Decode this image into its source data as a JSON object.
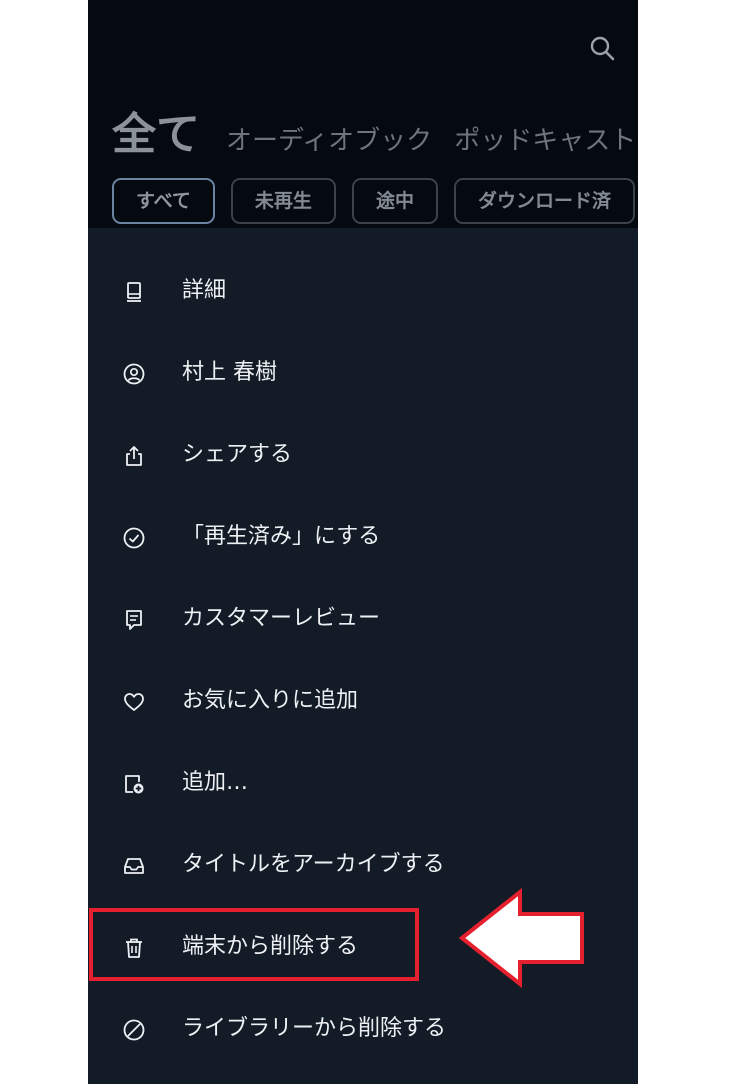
{
  "header": {
    "search_icon": "search-icon",
    "tabs": [
      {
        "label": "全て",
        "active": true
      },
      {
        "label": "オーディオブック",
        "active": false
      },
      {
        "label": "ポッドキャスト",
        "active": false
      }
    ],
    "filters": [
      {
        "label": "すべて",
        "selected": true
      },
      {
        "label": "未再生",
        "selected": false
      },
      {
        "label": "途中",
        "selected": false
      },
      {
        "label": "ダウンロード済",
        "selected": false
      }
    ]
  },
  "menu": {
    "items": [
      {
        "label": "詳細",
        "icon": "book-icon"
      },
      {
        "label": "村上 春樹",
        "icon": "person-icon"
      },
      {
        "label": "シェアする",
        "icon": "share-icon"
      },
      {
        "label": "「再生済み」にする",
        "icon": "check-circle-icon"
      },
      {
        "label": "カスタマーレビュー",
        "icon": "review-icon"
      },
      {
        "label": "お気に入りに追加",
        "icon": "heart-icon"
      },
      {
        "label": "追加…",
        "icon": "add-collection-icon"
      },
      {
        "label": "タイトルをアーカイブする",
        "icon": "archive-icon"
      },
      {
        "label": "端末から削除する",
        "icon": "trash-icon"
      },
      {
        "label": "ライブラリーから削除する",
        "icon": "block-icon"
      }
    ]
  },
  "annotation": {
    "highlight_color": "#e5202f",
    "arrow_color": "#e5202f",
    "highlighted_item": "端末から削除する"
  },
  "colors": {
    "header_bg": "#050a10",
    "menu_bg": "#121b26",
    "menu_text": "#eef1f4"
  }
}
